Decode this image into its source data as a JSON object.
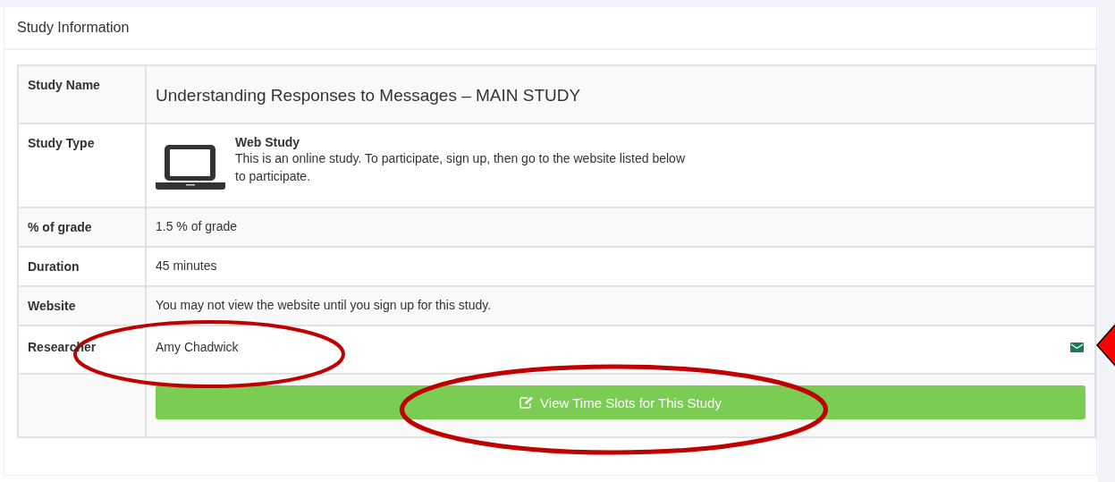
{
  "panel": {
    "title": "Study Information"
  },
  "rows": [
    {
      "kind": "title",
      "label": "Study Name",
      "value": "Understanding Responses to Messages – MAIN STUDY"
    },
    {
      "kind": "type",
      "label": "Study Type",
      "type_name": "Web Study",
      "description": "This is an online study. To participate, sign up, then go to the website listed below to participate."
    },
    {
      "kind": "text",
      "label": "% of grade",
      "value": "1.5 % of grade"
    },
    {
      "kind": "text",
      "label": "Duration",
      "value": "45 minutes"
    },
    {
      "kind": "text",
      "label": "Website",
      "value": "You may not view the website until you sign up for this study."
    },
    {
      "kind": "researcher",
      "label": "Researcher",
      "value": "Amy Chadwick"
    },
    {
      "kind": "action",
      "button": "View Time Slots for This Study"
    }
  ]
}
